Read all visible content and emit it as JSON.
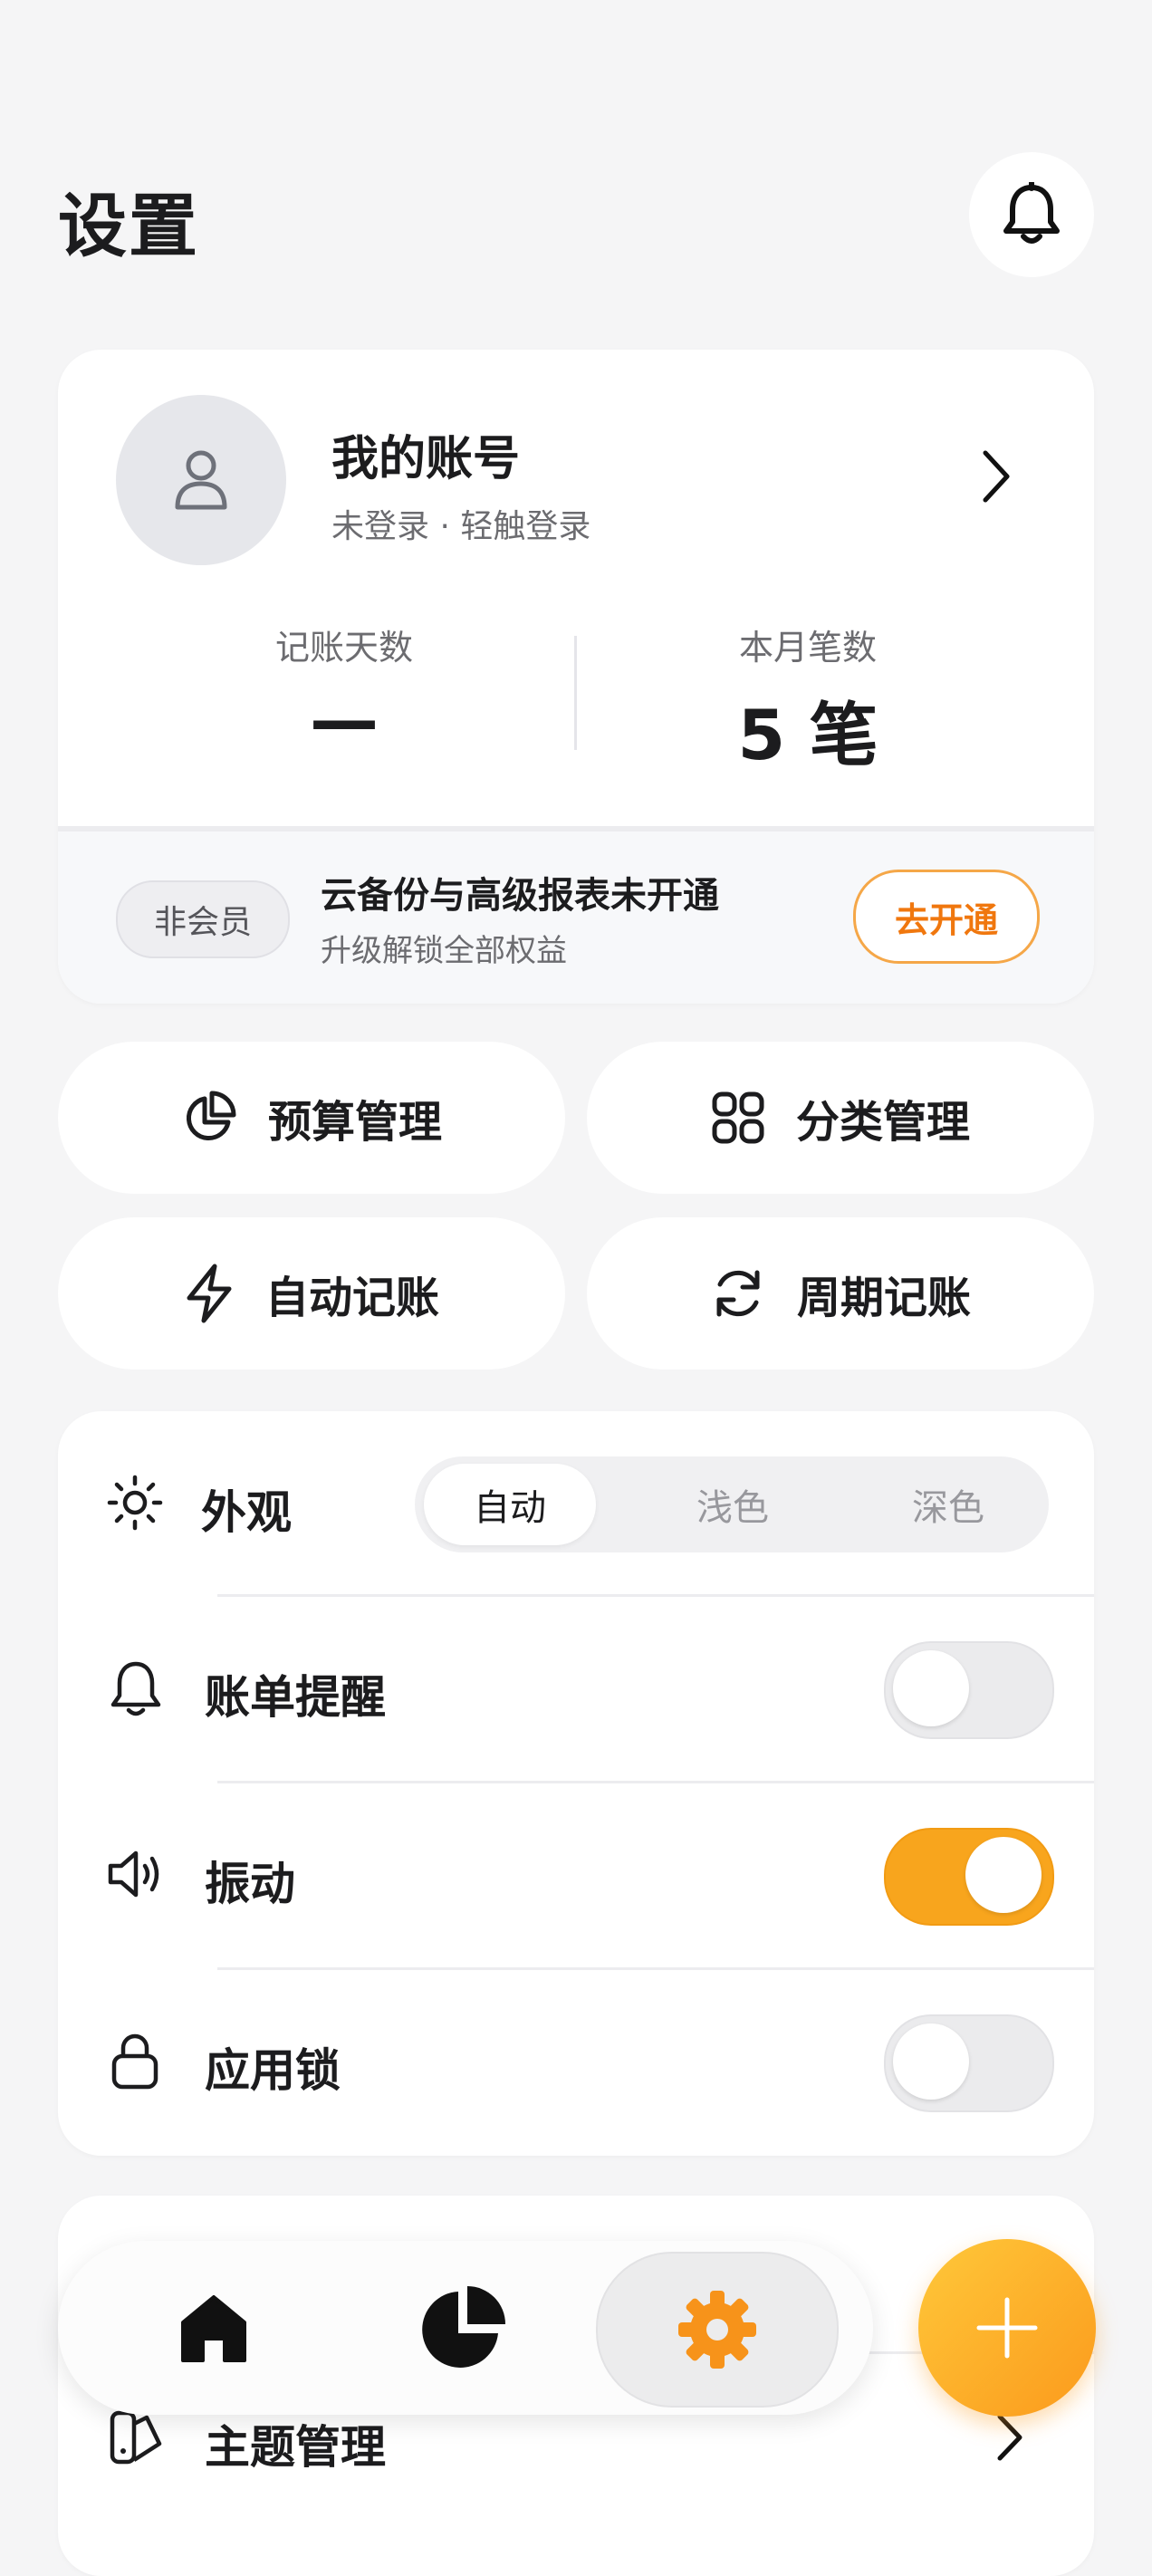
{
  "header": {
    "title": "设置",
    "bell_icon": "bell-icon"
  },
  "account": {
    "name": "我的账号",
    "subtitle": "未登录 · 轻触登录",
    "stats": [
      {
        "label": "记账天数",
        "value": "—"
      },
      {
        "label": "本月笔数",
        "value": "5 笔"
      }
    ],
    "membership": {
      "badge": "非会员",
      "title": "云备份与高级报表未开通",
      "subtitle": "升级解锁全部权益",
      "action": "去开通"
    }
  },
  "quick_actions": [
    {
      "label": "预算管理",
      "icon": "pie-chart-icon"
    },
    {
      "label": "分类管理",
      "icon": "grid-icon"
    },
    {
      "label": "自动记账",
      "icon": "lightning-icon"
    },
    {
      "label": "周期记账",
      "icon": "refresh-icon"
    }
  ],
  "settings": {
    "appearance": {
      "label": "外观",
      "options": [
        "自动",
        "浅色",
        "深色"
      ],
      "selected": "自动"
    },
    "bill_reminder": {
      "label": "账单提醒",
      "on": false
    },
    "vibration": {
      "label": "振动",
      "on": true
    },
    "app_lock": {
      "label": "应用锁",
      "on": false
    }
  },
  "theme": {
    "label": "主题管理"
  },
  "nav": {
    "items": [
      "home-icon",
      "chart-icon",
      "gear-icon"
    ],
    "active": "gear-icon"
  },
  "colors": {
    "accent": "#f8a51d",
    "accent_text": "#f0770e",
    "background": "#f5f5f6"
  }
}
